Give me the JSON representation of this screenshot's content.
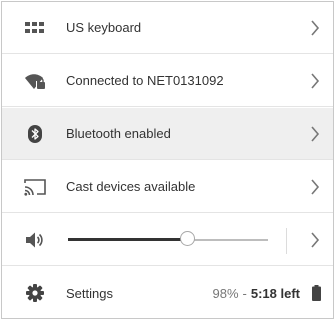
{
  "tray": {
    "keyboard": {
      "label": "US keyboard",
      "icon": "keyboard-icon"
    },
    "network": {
      "label": "Connected to NET0131092",
      "icon": "wifi-lock-icon"
    },
    "bluetooth": {
      "label": "Bluetooth enabled",
      "icon": "bluetooth-icon"
    },
    "cast": {
      "label": "Cast devices available",
      "icon": "cast-icon"
    },
    "volume": {
      "level_percent": 60,
      "icon": "volume-icon"
    },
    "settings": {
      "label": "Settings",
      "icon": "gear-icon"
    },
    "battery": {
      "percent": "98%",
      "separator": "-",
      "time_left": "5:18 left",
      "icon": "battery-icon"
    }
  },
  "colors": {
    "text": "#333333",
    "muted": "#777777",
    "hover_row": "#efefef",
    "icon": "#555555"
  }
}
